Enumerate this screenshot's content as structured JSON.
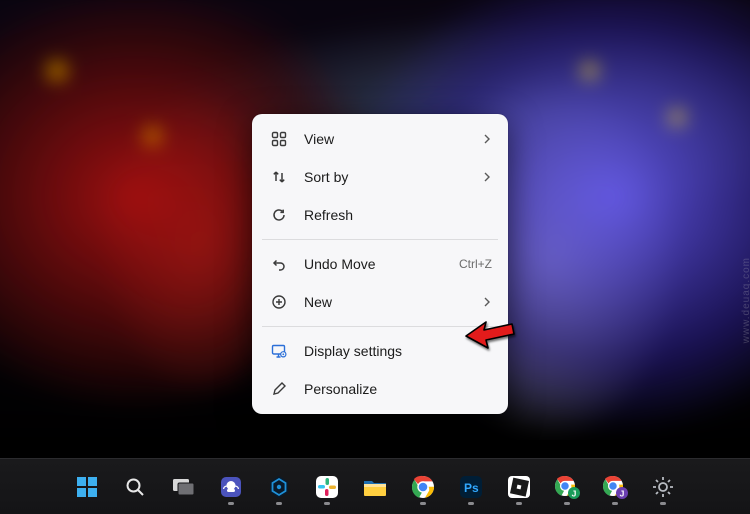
{
  "context_menu": {
    "items": [
      {
        "label": "View",
        "has_submenu": true,
        "icon": "grid-icon"
      },
      {
        "label": "Sort by",
        "has_submenu": true,
        "icon": "sort-icon"
      },
      {
        "label": "Refresh",
        "icon": "refresh-icon"
      }
    ],
    "items2": [
      {
        "label": "Undo Move",
        "shortcut": "Ctrl+Z",
        "icon": "undo-icon"
      },
      {
        "label": "New",
        "has_submenu": true,
        "icon": "new-icon"
      }
    ],
    "items3": [
      {
        "label": "Display settings",
        "icon": "display-settings-icon",
        "highlighted_by_arrow": true
      },
      {
        "label": "Personalize",
        "icon": "personalize-icon"
      }
    ]
  },
  "taskbar": {
    "buttons": [
      {
        "name": "start"
      },
      {
        "name": "search"
      },
      {
        "name": "task-view"
      },
      {
        "name": "chat"
      },
      {
        "name": "app-blue-hex"
      },
      {
        "name": "slack"
      },
      {
        "name": "file-explorer"
      },
      {
        "name": "chrome"
      },
      {
        "name": "photoshop"
      },
      {
        "name": "roblox"
      },
      {
        "name": "chrome-profile-j-1"
      },
      {
        "name": "chrome-profile-j-2"
      },
      {
        "name": "settings"
      }
    ]
  },
  "watermark": "www.deuaq.com"
}
